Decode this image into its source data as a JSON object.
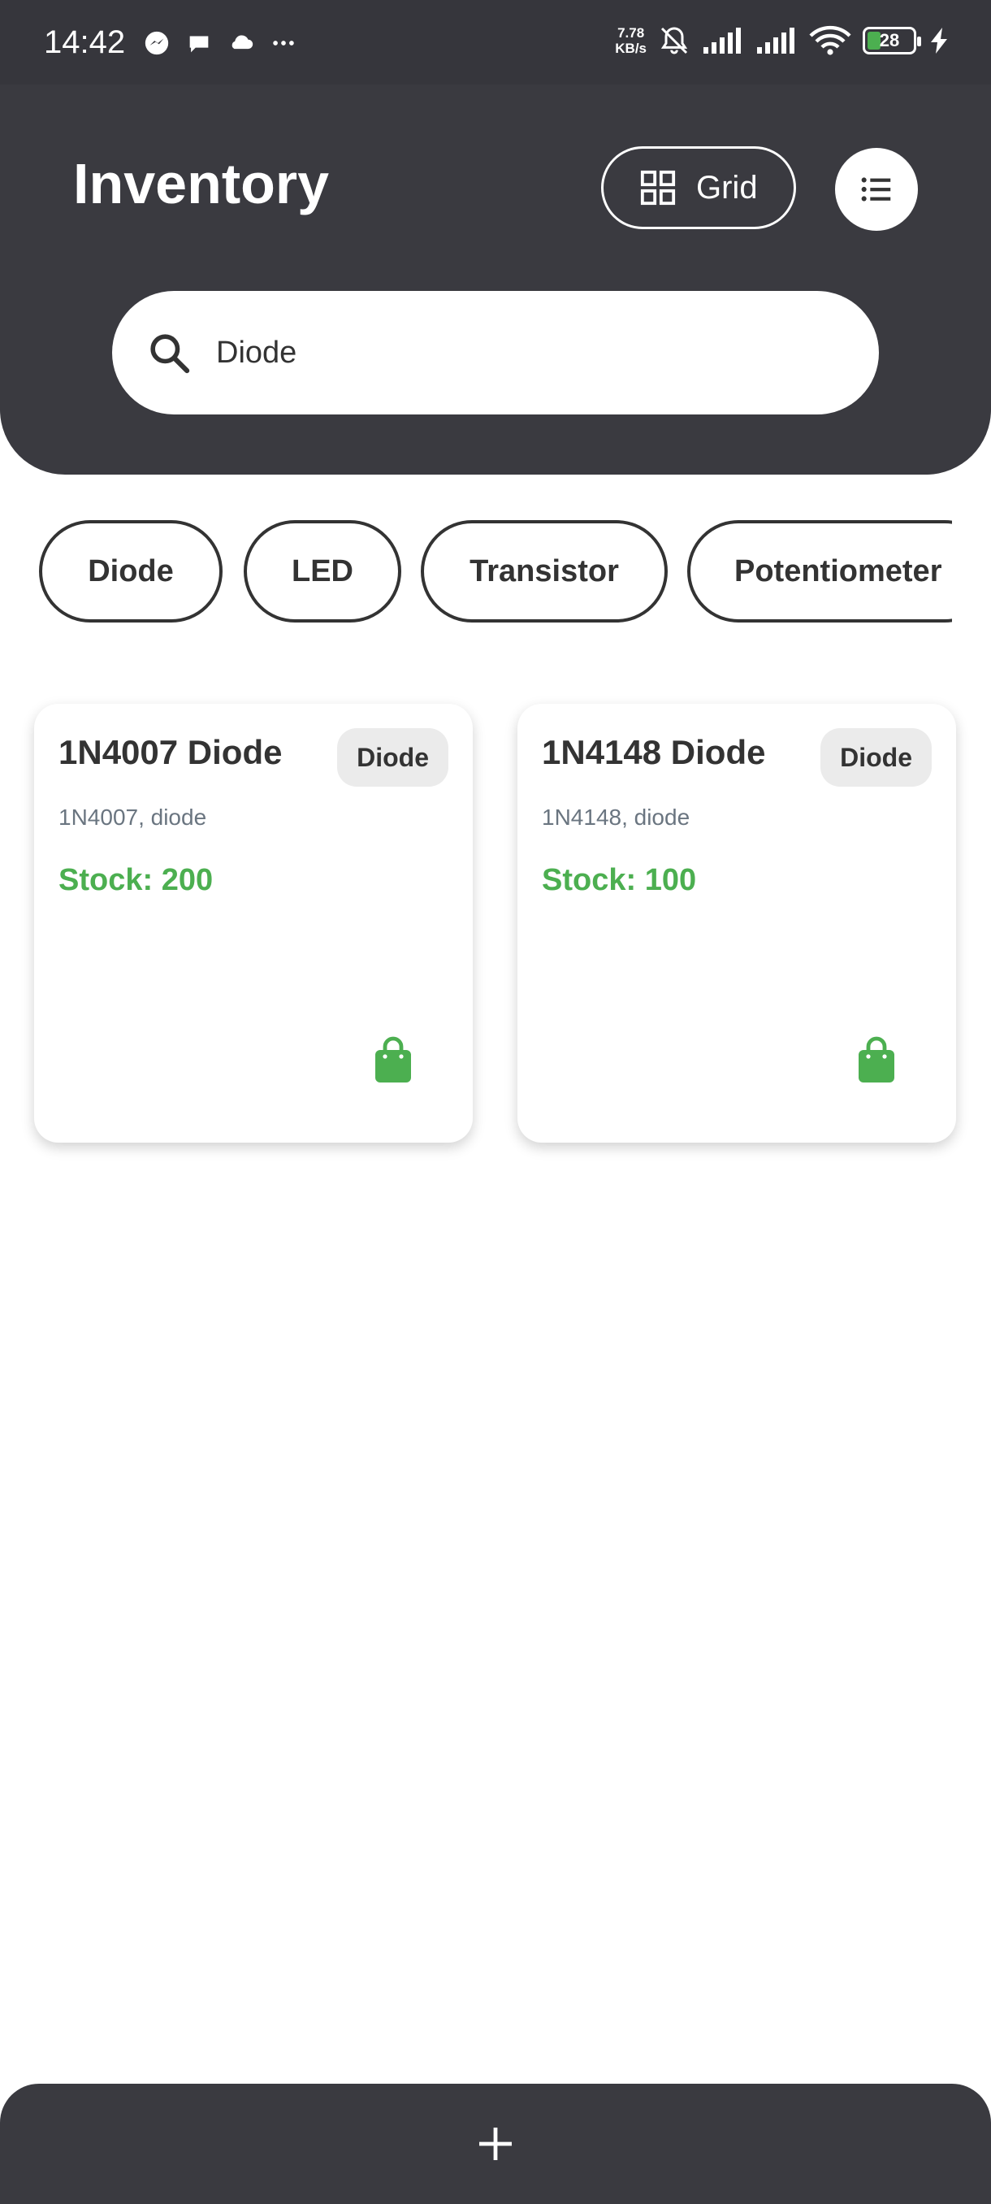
{
  "status_bar": {
    "time": "14:42",
    "net_speed_value": "7.78",
    "net_speed_unit": "KB/s",
    "battery": "28",
    "icons": [
      "messenger-icon",
      "chat-icon",
      "cloud-icon",
      "more-dots-icon",
      "bell-off-icon",
      "signal-icon",
      "signal-icon",
      "wifi-icon",
      "battery-icon",
      "charging-icon"
    ]
  },
  "header": {
    "title": "Inventory",
    "view_toggle_label": "Grid",
    "background_color": "#3a3a40"
  },
  "search": {
    "value": "Diode",
    "placeholder": "Search"
  },
  "filters": [
    {
      "label": "Diode"
    },
    {
      "label": "LED"
    },
    {
      "label": "Transistor"
    },
    {
      "label": "Potentiometer"
    }
  ],
  "items": [
    {
      "name": "1N4007 Diode",
      "category": "Diode",
      "tags": "1N4007, diode",
      "stock": "Stock: 200"
    },
    {
      "name": "1N4148 Diode",
      "category": "Diode",
      "tags": "1N4148, diode",
      "stock": "Stock: 100"
    }
  ],
  "colors": {
    "accent": "#4caf50",
    "dark": "#3a3a40",
    "badge_bg": "#ebebeb"
  },
  "fab": {
    "icon": "plus-icon"
  }
}
